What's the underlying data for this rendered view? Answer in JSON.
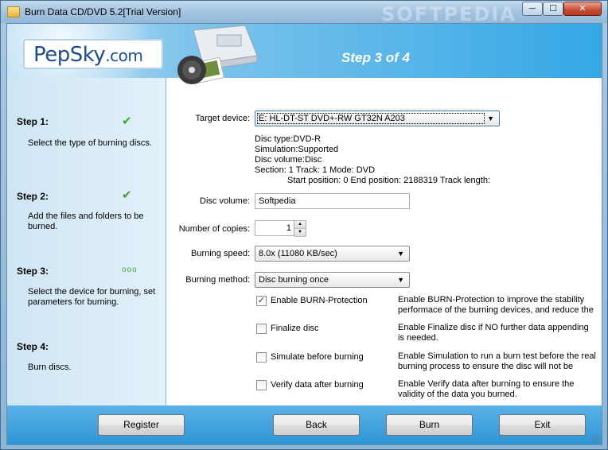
{
  "window": {
    "title": "Burn Data CD/DVD 5.2[Trial Version]",
    "watermark": "SOFTPEDIA",
    "min_glyph": "─",
    "max_glyph": "☐",
    "close_glyph": "✕"
  },
  "header": {
    "logo_main": "PepSky",
    "logo_suffix": ".com",
    "step_title": "Step 3 of 4"
  },
  "sidebar": {
    "steps": [
      {
        "heading": "Step 1:",
        "desc": "Select the type of burning discs.",
        "status": "done"
      },
      {
        "heading": "Step 2:",
        "desc": "Add the files and folders to be burned.",
        "status": "done"
      },
      {
        "heading": "Step 3:",
        "desc": "Select the device for burning, set parameters for burning.",
        "status": "current"
      },
      {
        "heading": "Step 4:",
        "desc": "Burn discs.",
        "status": "pending"
      }
    ],
    "done_glyph": "✔",
    "current_glyph": "ooo"
  },
  "form": {
    "target_device_label": "Target device:",
    "target_device_value": "E:  HL-DT-ST DVD+-RW GT32N    A203",
    "disc_info": [
      "Disc type:DVD-R",
      "Simulation:Supported",
      "Disc volume:Disc",
      "Section: 1 Track: 1 Mode: DVD",
      "Start position: 0 End position: 2188319 Track length:"
    ],
    "disc_volume_label": "Disc volume:",
    "disc_volume_value": "Softpedia",
    "copies_label": "Number of copies:",
    "copies_value": "1",
    "speed_label": "Burning speed:",
    "speed_value": "8.0x (11080 KB/sec)",
    "method_label": "Burning method:",
    "method_value": "Disc burning once",
    "dropdown_glyph": "▼",
    "spin_up_glyph": "▲",
    "spin_down_glyph": "▼",
    "options": [
      {
        "label": "Enable BURN-Protection",
        "checked": true,
        "desc": "Enable BURN-Protection to improve the stability performace of the burning devices, and reduce the"
      },
      {
        "label": "Finalize disc",
        "checked": false,
        "desc": "Enable Finalize disc if NO further data appending is needed."
      },
      {
        "label": "Simulate before burning",
        "checked": false,
        "desc": "Enable Simulation to run a burn test before the real burning process to ensure the disc will not be"
      },
      {
        "label": "Verify data after burning",
        "checked": false,
        "desc": "Enable Verify data after burning to ensure the validity of the data you burned."
      }
    ],
    "check_glyph": "✓"
  },
  "footer": {
    "register_label": "Register",
    "back_label": "Back",
    "burn_label": "Burn",
    "exit_label": "Exit"
  }
}
